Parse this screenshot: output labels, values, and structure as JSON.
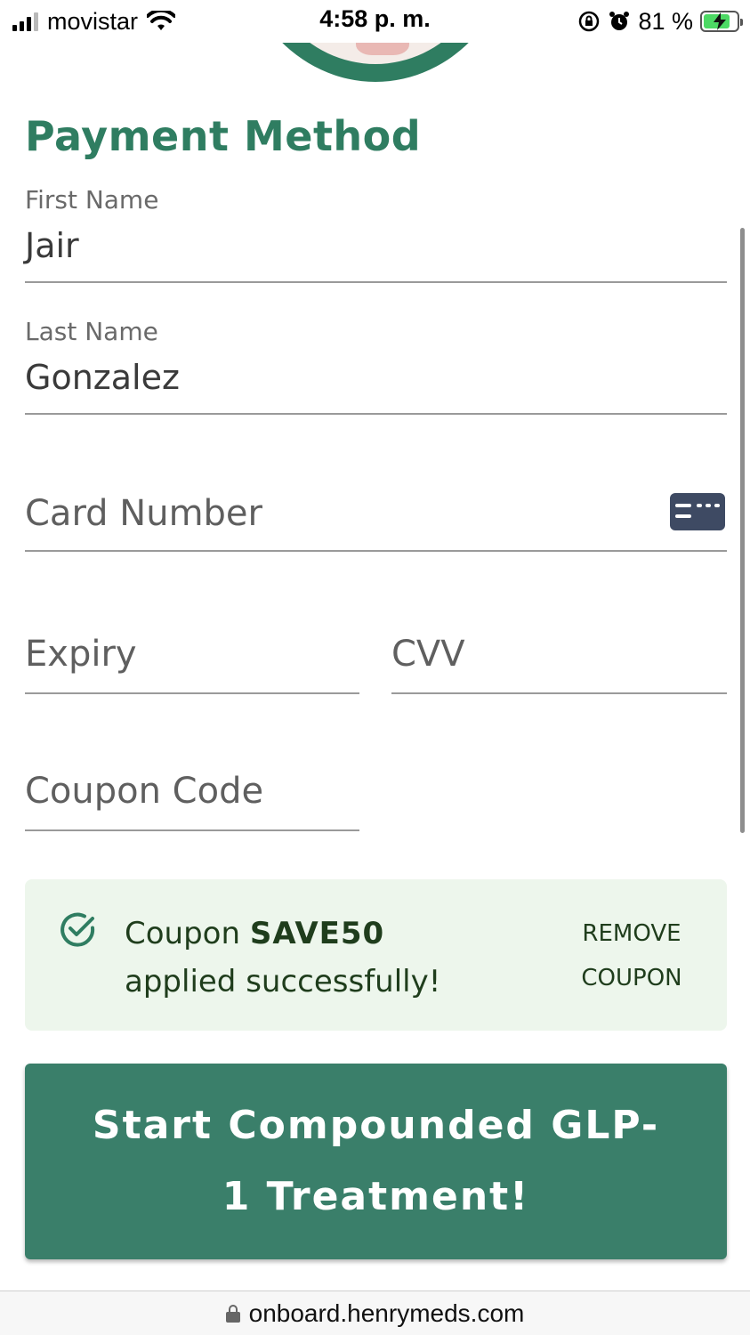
{
  "status_bar": {
    "carrier": "movistar",
    "time": "4:58 p. m.",
    "battery_percent": "81 %",
    "battery_level": 0.81,
    "signal_bars_active": 3,
    "signal_bars_total": 4
  },
  "header": {
    "title": "Payment Method"
  },
  "form": {
    "first_name": {
      "label": "First Name",
      "value": "Jair"
    },
    "last_name": {
      "label": "Last Name",
      "value": "Gonzalez"
    },
    "card_number": {
      "placeholder": "Card Number",
      "icon": "credit-card-icon"
    },
    "expiry": {
      "placeholder": "Expiry"
    },
    "cvv": {
      "placeholder": "CVV"
    },
    "coupon_code": {
      "placeholder": "Coupon Code"
    }
  },
  "coupon_banner": {
    "prefix": "Coupon ",
    "code": "SAVE50",
    "suffix": "applied successfully!",
    "remove_label_line1": "REMOVE",
    "remove_label_line2": "COUPON",
    "icon": "check-circle-icon"
  },
  "cta": {
    "label": "Start Compounded GLP-1 Treatment!"
  },
  "browser": {
    "url": "onboard.henrymeds.com"
  },
  "colors": {
    "brand_green": "#2f7d61",
    "button_green": "#3a7f6a",
    "success_bg": "#edf6ec",
    "success_text": "#1f3d1c"
  }
}
